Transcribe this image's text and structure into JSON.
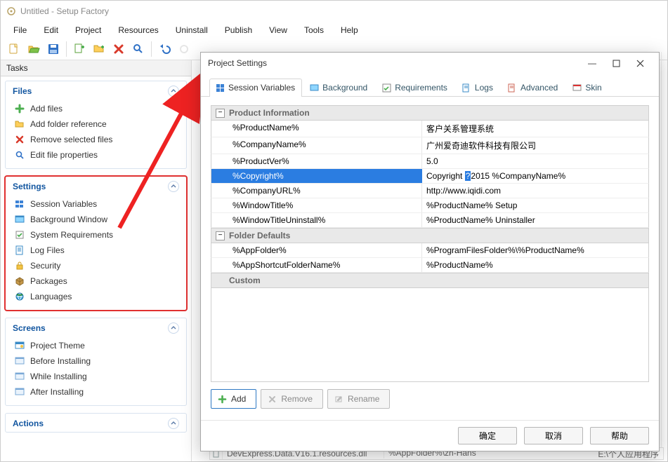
{
  "window": {
    "title": "Untitled - Setup Factory"
  },
  "menus": [
    "File",
    "Edit",
    "Project",
    "Resources",
    "Uninstall",
    "Publish",
    "View",
    "Tools",
    "Help"
  ],
  "sidebar": {
    "header": "Tasks",
    "panels": {
      "files": {
        "title": "Files",
        "items": [
          {
            "icon": "plus",
            "label": "Add files"
          },
          {
            "icon": "folder",
            "label": "Add folder reference"
          },
          {
            "icon": "x",
            "label": "Remove selected files"
          },
          {
            "icon": "search",
            "label": "Edit file properties"
          }
        ]
      },
      "settings": {
        "title": "Settings",
        "items": [
          {
            "icon": "vars",
            "label": "Session Variables"
          },
          {
            "icon": "bg",
            "label": "Background Window"
          },
          {
            "icon": "req",
            "label": "System Requirements"
          },
          {
            "icon": "log",
            "label": "Log Files"
          },
          {
            "icon": "lock",
            "label": "Security"
          },
          {
            "icon": "pkg",
            "label": "Packages"
          },
          {
            "icon": "globe",
            "label": "Languages"
          }
        ]
      },
      "screens": {
        "title": "Screens",
        "items": [
          {
            "icon": "theme",
            "label": "Project Theme"
          },
          {
            "icon": "scr",
            "label": "Before Installing"
          },
          {
            "icon": "scr",
            "label": "While Installing"
          },
          {
            "icon": "scr",
            "label": "After Installing"
          }
        ]
      },
      "actions": {
        "title": "Actions"
      }
    }
  },
  "dialog": {
    "title": "Project Settings",
    "tabs": [
      {
        "icon": "vars",
        "label": "Session Variables",
        "active": true
      },
      {
        "icon": "bg",
        "label": "Background"
      },
      {
        "icon": "req",
        "label": "Requirements"
      },
      {
        "icon": "log",
        "label": "Logs"
      },
      {
        "icon": "adv",
        "label": "Advanced"
      },
      {
        "icon": "skin",
        "label": "Skin"
      }
    ],
    "sections": {
      "product": {
        "title": "Product Information",
        "rows": [
          {
            "k": "%ProductName%",
            "v": "客户关系管理系统"
          },
          {
            "k": "%CompanyName%",
            "v": "广州爱奇迪软件科技有限公司"
          },
          {
            "k": "%ProductVer%",
            "v": "5.0"
          },
          {
            "k": "%Copyright%",
            "v_pre": "Copyright ",
            "v_hl": "?",
            "v_post": "2015 %CompanyName%",
            "selected": true
          },
          {
            "k": "%CompanyURL%",
            "v": "http://www.iqidi.com"
          },
          {
            "k": "%WindowTitle%",
            "v": "%ProductName% Setup"
          },
          {
            "k": "%WindowTitleUninstall%",
            "v": "%ProductName% Uninstaller"
          }
        ]
      },
      "folders": {
        "title": "Folder Defaults",
        "rows": [
          {
            "k": "%AppFolder%",
            "v": "%ProgramFilesFolder%\\%ProductName%"
          },
          {
            "k": "%AppShortcutFolderName%",
            "v": "%ProductName%"
          }
        ]
      },
      "custom": {
        "title": "Custom"
      }
    },
    "buttons": {
      "add": "Add",
      "remove": "Remove",
      "rename": "Rename"
    },
    "footer": {
      "ok": "确定",
      "cancel": "取消",
      "help": "帮助"
    }
  },
  "peek": {
    "file": "DevExpress.Data.V16.1.resources.dll",
    "path": "%AppFolder%\\zh-Hans",
    "tail": "E:\\个人应用程序"
  }
}
